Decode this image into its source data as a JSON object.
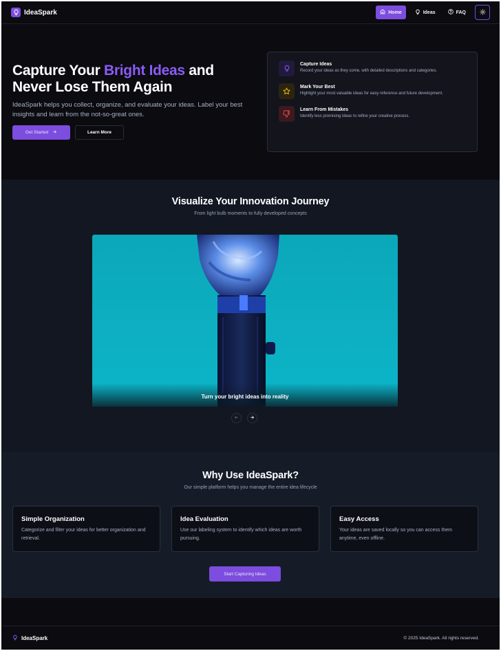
{
  "nav": {
    "brand": "IdeaSpark",
    "links": [
      {
        "label": "Home",
        "icon": "home-icon"
      },
      {
        "label": "Ideas",
        "icon": "lightbulb-icon"
      },
      {
        "label": "FAQ",
        "icon": "help-circle-icon"
      }
    ],
    "theme_toggle_icon": "sun-icon"
  },
  "hero": {
    "title_part1": "Capture Your ",
    "title_accent": "Bright Ideas",
    "title_part2": " and Never Lose Them Again",
    "subtitle": "IdeaSpark helps you collect, organize, and evaluate your ideas. Label your best insights and learn from the not-so-great ones.",
    "primary_button": "Get Started",
    "secondary_button": "Learn More",
    "features": [
      {
        "title": "Capture Ideas",
        "desc": "Record your ideas as they come, with detailed descriptions and categories.",
        "icon": "lightbulb-icon"
      },
      {
        "title": "Mark Your Best",
        "desc": "Highlight your most valuable ideas for easy reference and future development.",
        "icon": "star-icon"
      },
      {
        "title": "Learn From Mistakes",
        "desc": "Identify less promising ideas to refine your creative process.",
        "icon": "thumbs-down-icon"
      }
    ]
  },
  "visualize": {
    "title": "Visualize Your Innovation Journey",
    "subtitle": "From light bulb moments to fully developed concepts",
    "slide_caption": "Turn your bright ideas into reality"
  },
  "why": {
    "title": "Why Use IdeaSpark?",
    "subtitle": "Our simple platform helps you manage the entire idea lifecycle",
    "cards": [
      {
        "title": "Simple Organization",
        "desc": "Categorize and filter your ideas for better organization and retrieval."
      },
      {
        "title": "Idea Evaluation",
        "desc": "Use our labeling system to identify which ideas are worth pursuing."
      },
      {
        "title": "Easy Access",
        "desc": "Your ideas are saved locally so you can access them anytime, even offline."
      }
    ],
    "cta": "Start Capturing Ideas"
  },
  "footer": {
    "brand": "IdeaSpark",
    "copyright": "© 2025 IdeaSpark. All rights reserved."
  },
  "colors": {
    "accent": "#7c4dde",
    "accent_text": "#8b5cf6",
    "background": "#0b0b10",
    "section_bg": "#121722",
    "carousel_bg": "#0db0c2"
  }
}
